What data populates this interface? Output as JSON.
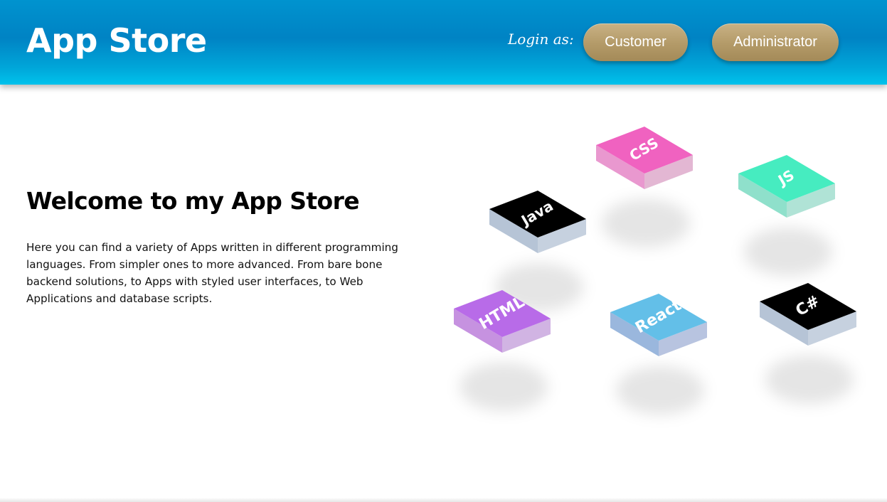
{
  "header": {
    "brand": "App Store",
    "login_label": "Login as:",
    "buttons": {
      "customer": "Customer",
      "administrator": "Administrator"
    }
  },
  "main": {
    "title": "Welcome to my App Store",
    "intro": "Here you can find a variety of Apps written in different programming languages. From simpler ones to more advanced. From bare bone backend solutions, to Apps with styled user interfaces, to Web Applications and database scripts."
  },
  "tiles": [
    {
      "label": "CSS",
      "color": "#f062c0",
      "side_left": "#e998cf",
      "side_right": "#e3b7d3"
    },
    {
      "label": "JS",
      "color": "#46ecc0",
      "side_left": "#8fe0cb",
      "side_right": "#b0e3d6"
    },
    {
      "label": "Java",
      "color": "#000000",
      "side_left": "#b6c4d6",
      "side_right": "#c6d1df"
    },
    {
      "label": "HTML",
      "color": "#b86be8",
      "side_left": "#c692e0",
      "side_right": "#d1b4e3"
    },
    {
      "label": "React",
      "color": "#63bfe8",
      "side_left": "#9ab7dd",
      "side_right": "#b8c4e0"
    },
    {
      "label": "C#",
      "color": "#000000",
      "side_left": "#b6c4d6",
      "side_right": "#c6d1df"
    }
  ],
  "colors": {
    "header_blue": "#0083c4",
    "header_cyan": "#00c2ec",
    "button_gold": "#b39a68"
  }
}
